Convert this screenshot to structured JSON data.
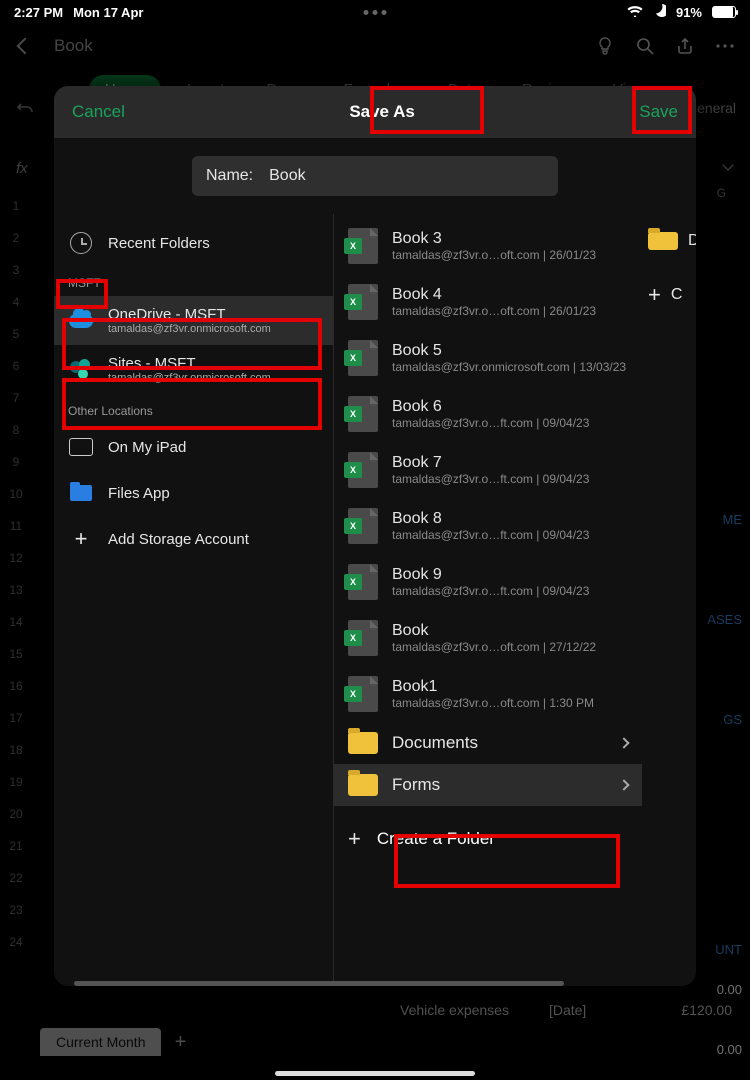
{
  "statusbar": {
    "time": "2:27 PM",
    "date": "Mon 17 Apr",
    "battery": "91%"
  },
  "app": {
    "back_label": "Book"
  },
  "ribbon": {
    "tabs": [
      "Home",
      "Insert",
      "Draw",
      "Formulas",
      "Data",
      "Review",
      "View"
    ],
    "active": 0,
    "number_format": "General"
  },
  "fx": {
    "label": "fx",
    "col_g": "G"
  },
  "modal": {
    "cancel": "Cancel",
    "title": "Save As",
    "save": "Save",
    "name_label": "Name:",
    "name_value": "Book"
  },
  "sidebar": {
    "recent": "Recent Folders",
    "account_label": "MSFT",
    "onedrive": {
      "title": "OneDrive - MSFT",
      "sub": "tamaldas@zf3vr.onmicrosoft.com"
    },
    "sites": {
      "title": "Sites - MSFT",
      "sub": "tamaldas@zf3vr.onmicrosoft.com"
    },
    "other_label": "Other Locations",
    "ipad": "On My iPad",
    "files": "Files App",
    "add": "Add Storage Account"
  },
  "files": [
    {
      "name": "Book 3",
      "sub": "tamaldas@zf3vr.o…oft.com | 26/01/23"
    },
    {
      "name": "Book 4",
      "sub": "tamaldas@zf3vr.o…oft.com | 26/01/23"
    },
    {
      "name": "Book 5",
      "sub": "tamaldas@zf3vr.onmicrosoft.com | 13/03/23"
    },
    {
      "name": "Book 6",
      "sub": "tamaldas@zf3vr.o…ft.com | 09/04/23"
    },
    {
      "name": "Book 7",
      "sub": "tamaldas@zf3vr.o…ft.com | 09/04/23"
    },
    {
      "name": "Book 8",
      "sub": "tamaldas@zf3vr.o…ft.com | 09/04/23"
    },
    {
      "name": "Book 9",
      "sub": "tamaldas@zf3vr.o…ft.com | 09/04/23"
    },
    {
      "name": "Book",
      "sub": "tamaldas@zf3vr.o…oft.com | 27/12/22"
    },
    {
      "name": "Book1",
      "sub": "tamaldas@zf3vr.o…oft.com | 1:30 PM"
    }
  ],
  "folders": {
    "documents": "Documents",
    "forms": "Forms",
    "create": "Create a Folder"
  },
  "rightcol": {
    "d": "D",
    "c": "C"
  },
  "bg": {
    "me": "ME",
    "ases": "ASES",
    "gs": "GS",
    "unt": "UNT",
    "v00a": "0.00",
    "v00b": "0.00",
    "vehicle": "Vehicle expenses",
    "date": "[Date]",
    "amount": "£120.00"
  },
  "sheet": {
    "tab": "Current Month"
  }
}
